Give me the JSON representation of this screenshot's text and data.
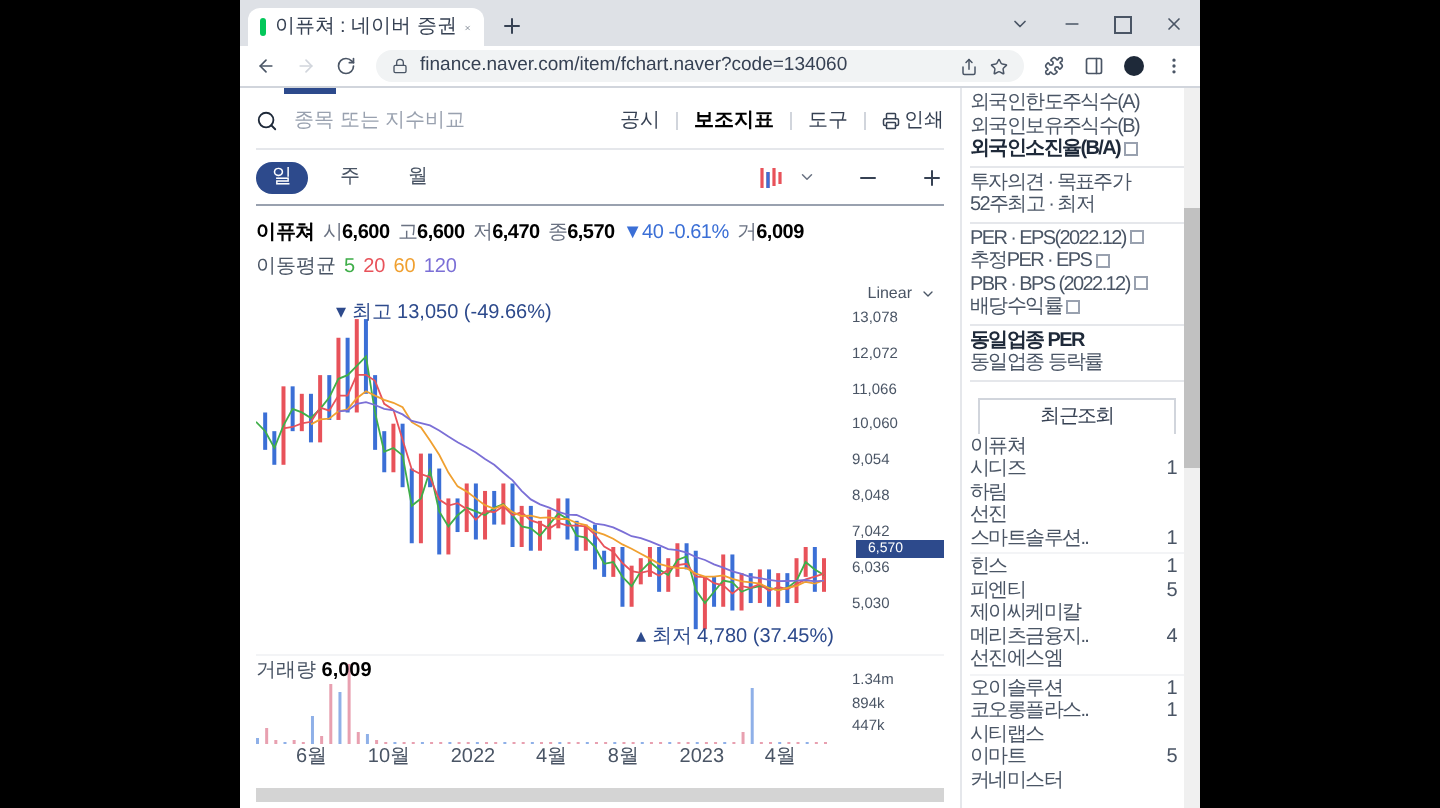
{
  "browser": {
    "tab_title": "이퓨쳐 : 네이버 증권",
    "url": "finance.naver.com/item/fchart.naver?code=134060"
  },
  "search": {
    "placeholder": "종목 또는 지수비교"
  },
  "toolbar_links": [
    {
      "label": "공시",
      "selected": false
    },
    {
      "label": "보조지표",
      "selected": true
    },
    {
      "label": "도구",
      "selected": false
    },
    {
      "label": "인쇄",
      "selected": false,
      "kind": "print"
    }
  ],
  "periods": [
    {
      "label": "일",
      "selected": true
    },
    {
      "label": "주",
      "selected": false
    },
    {
      "label": "월",
      "selected": false
    }
  ],
  "quote": {
    "name": "이퓨쳐",
    "fields": [
      {
        "label": "시",
        "value": "6,600"
      },
      {
        "label": "고",
        "value": "6,600"
      },
      {
        "label": "저",
        "value": "6,470"
      },
      {
        "label": "종",
        "value": "6,570"
      }
    ],
    "change": "▼40",
    "change_pct": "-0.61%",
    "volume_label": "거",
    "volume": "6,009"
  },
  "moving_average": {
    "label": "이동평균",
    "periods": [
      {
        "label": "5",
        "color": "#3fae49"
      },
      {
        "label": "20",
        "color": "#e8525a"
      },
      {
        "label": "60",
        "color": "#f0a030"
      },
      {
        "label": "120",
        "color": "#7b6fd6"
      }
    ]
  },
  "scale": "Linear",
  "y_labels": [
    "13,078",
    "12,072",
    "11,066",
    "10,060",
    "9,054",
    "8,048",
    "7,042",
    "6,036",
    "5,030"
  ],
  "high_marker": "▾ 최고 13,050 (-49.66%)",
  "low_marker": "▴ 최저 4,780 (37.45%)",
  "current_price": "6,570",
  "volume_panel": {
    "label": "거래량",
    "value": "6,009",
    "y_labels": [
      "1.34m",
      "894k",
      "447k"
    ]
  },
  "x_labels": [
    "6월",
    "10월",
    "2022",
    "4월",
    "8월",
    "2023",
    "4월"
  ],
  "sidebar": {
    "groups": [
      {
        "items": [
          {
            "label": "외국인한도주식수(A)",
            "emphasis": false,
            "help": false
          },
          {
            "label": "외국인보유주식수(B)",
            "emphasis": false,
            "help": false
          },
          {
            "label": "외국인소진율(B/A)",
            "emphasis": true,
            "help": true
          }
        ]
      },
      {
        "items": [
          {
            "label": "투자의견 · 목표주가",
            "emphasis": false,
            "help": false
          },
          {
            "label": "52주최고 · 최저",
            "emphasis": false,
            "help": false
          }
        ]
      },
      {
        "items": [
          {
            "label": "PER · EPS(2022.12)",
            "emphasis": false,
            "help": true
          },
          {
            "label": "추정PER · EPS",
            "emphasis": false,
            "help": true
          },
          {
            "label": "PBR · BPS (2022.12)",
            "emphasis": false,
            "help": true
          },
          {
            "label": "배당수익률",
            "emphasis": false,
            "help": true
          }
        ]
      },
      {
        "items": [
          {
            "label": "동일업종 PER",
            "emphasis": true,
            "help": false
          },
          {
            "label": "동일업종 등락률",
            "emphasis": false,
            "help": false
          }
        ]
      }
    ],
    "recent": {
      "title": "최근조회",
      "groups": [
        [
          {
            "name": "이퓨쳐"
          },
          {
            "name": "시디즈",
            "count": "1"
          },
          {
            "name": "하림"
          },
          {
            "name": "선진"
          },
          {
            "name": "스마트솔루션..",
            "count": "1"
          }
        ],
        [
          {
            "name": "힌스",
            "count": "1"
          },
          {
            "name": "피엔티",
            "count": "5"
          },
          {
            "name": "제이씨케미칼"
          },
          {
            "name": "메리츠금융지..",
            "count": "4"
          },
          {
            "name": "선진에스엠"
          }
        ],
        [
          {
            "name": "오이솔루션",
            "count": "1"
          },
          {
            "name": "코오롱플라스..",
            "count": "1"
          },
          {
            "name": "시티랩스"
          },
          {
            "name": "이마트",
            "count": "5"
          },
          {
            "name": "커네미스터"
          }
        ]
      ]
    }
  }
}
